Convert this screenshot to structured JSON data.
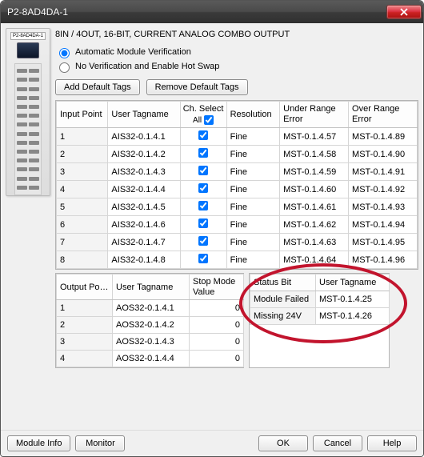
{
  "window": {
    "title": "P2-8AD4DA-1"
  },
  "subtitle": "8IN / 4OUT, 16-BIT, CURRENT ANALOG COMBO OUTPUT",
  "module_label": "P2-8AD4DA-1",
  "radios": {
    "auto": "Automatic Module Verification",
    "hotswap": "No Verification and Enable Hot Swap"
  },
  "buttons": {
    "add_tags": "Add Default Tags",
    "remove_tags": "Remove Default Tags",
    "module_info": "Module Info",
    "monitor": "Monitor",
    "ok": "OK",
    "cancel": "Cancel",
    "help": "Help"
  },
  "input_table": {
    "headers": {
      "c1": "Input Point",
      "c2": "User Tagname",
      "c3a": "Ch. Select",
      "c3b": "All",
      "c4": "Resolution",
      "c5a": "Under Range",
      "c5b": "Error",
      "c6a": "Over Range",
      "c6b": "Error"
    },
    "rows": [
      {
        "n": "1",
        "tag": "AIS32-0.1.4.1",
        "sel": true,
        "res": "Fine",
        "under": "MST-0.1.4.57",
        "over": "MST-0.1.4.89"
      },
      {
        "n": "2",
        "tag": "AIS32-0.1.4.2",
        "sel": true,
        "res": "Fine",
        "under": "MST-0.1.4.58",
        "over": "MST-0.1.4.90"
      },
      {
        "n": "3",
        "tag": "AIS32-0.1.4.3",
        "sel": true,
        "res": "Fine",
        "under": "MST-0.1.4.59",
        "over": "MST-0.1.4.91"
      },
      {
        "n": "4",
        "tag": "AIS32-0.1.4.4",
        "sel": true,
        "res": "Fine",
        "under": "MST-0.1.4.60",
        "over": "MST-0.1.4.92"
      },
      {
        "n": "5",
        "tag": "AIS32-0.1.4.5",
        "sel": true,
        "res": "Fine",
        "under": "MST-0.1.4.61",
        "over": "MST-0.1.4.93"
      },
      {
        "n": "6",
        "tag": "AIS32-0.1.4.6",
        "sel": true,
        "res": "Fine",
        "under": "MST-0.1.4.62",
        "over": "MST-0.1.4.94"
      },
      {
        "n": "7",
        "tag": "AIS32-0.1.4.7",
        "sel": true,
        "res": "Fine",
        "under": "MST-0.1.4.63",
        "over": "MST-0.1.4.95"
      },
      {
        "n": "8",
        "tag": "AIS32-0.1.4.8",
        "sel": true,
        "res": "Fine",
        "under": "MST-0.1.4.64",
        "over": "MST-0.1.4.96"
      }
    ]
  },
  "output_table": {
    "headers": {
      "c1": "Output Point",
      "c2": "User Tagname",
      "c3a": "Stop Mode",
      "c3b": "Value"
    },
    "rows": [
      {
        "n": "1",
        "tag": "AOS32-0.1.4.1",
        "val": "0"
      },
      {
        "n": "2",
        "tag": "AOS32-0.1.4.2",
        "val": "0"
      },
      {
        "n": "3",
        "tag": "AOS32-0.1.4.3",
        "val": "0"
      },
      {
        "n": "4",
        "tag": "AOS32-0.1.4.4",
        "val": "0"
      }
    ]
  },
  "status_table": {
    "headers": {
      "c1": "Status Bit",
      "c2": "User Tagname"
    },
    "rows": [
      {
        "bit": "Module Failed",
        "tag": "MST-0.1.4.25"
      },
      {
        "bit": "Missing 24V",
        "tag": "MST-0.1.4.26"
      }
    ]
  }
}
